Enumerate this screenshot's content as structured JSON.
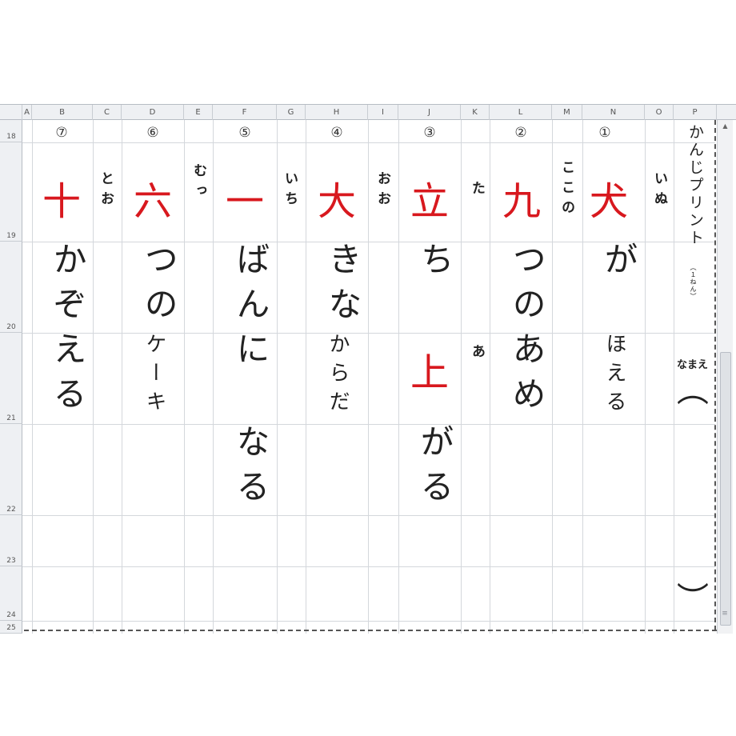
{
  "columns": [
    "A",
    "B",
    "C",
    "D",
    "E",
    "F",
    "G",
    "H",
    "I",
    "J",
    "K",
    "L",
    "M",
    "N",
    "O",
    "P"
  ],
  "rows": [
    "18",
    "19",
    "20",
    "21",
    "22",
    "23",
    "24",
    "25"
  ],
  "title": "かんじプリント",
  "grade": "（１ねん）",
  "name_label": "なまえ",
  "name_open": "（",
  "name_close": "）",
  "items": [
    {
      "num": "①",
      "kanji": "犬",
      "reading": "いぬ",
      "sentence": "が",
      "sentence2": "ほえる"
    },
    {
      "num": "②",
      "kanji": "九",
      "reading": "ここの",
      "sentence": "つのあめ",
      "sentence2": ""
    },
    {
      "num": "③",
      "kanji": "立",
      "reading": "た",
      "sentence": "ち",
      "kanji2": "上",
      "reading2": "あ",
      "sentence2": "がる"
    },
    {
      "num": "④",
      "kanji": "大",
      "reading": "おお",
      "sentence": "きな",
      "sentence2": "からだ"
    },
    {
      "num": "⑤",
      "kanji": "一",
      "reading": "いち",
      "sentence": "ばんに",
      "sentence2": "なる"
    },
    {
      "num": "⑥",
      "kanji": "六",
      "reading": "むっ",
      "sentence": "つの",
      "sentence2": "ケーキ"
    },
    {
      "num": "⑦",
      "kanji": "十",
      "reading": "とお",
      "sentence": "かぞえる",
      "sentence2": ""
    }
  ],
  "scrollbar": {
    "up_arrow": "▲",
    "grip": "≡"
  }
}
